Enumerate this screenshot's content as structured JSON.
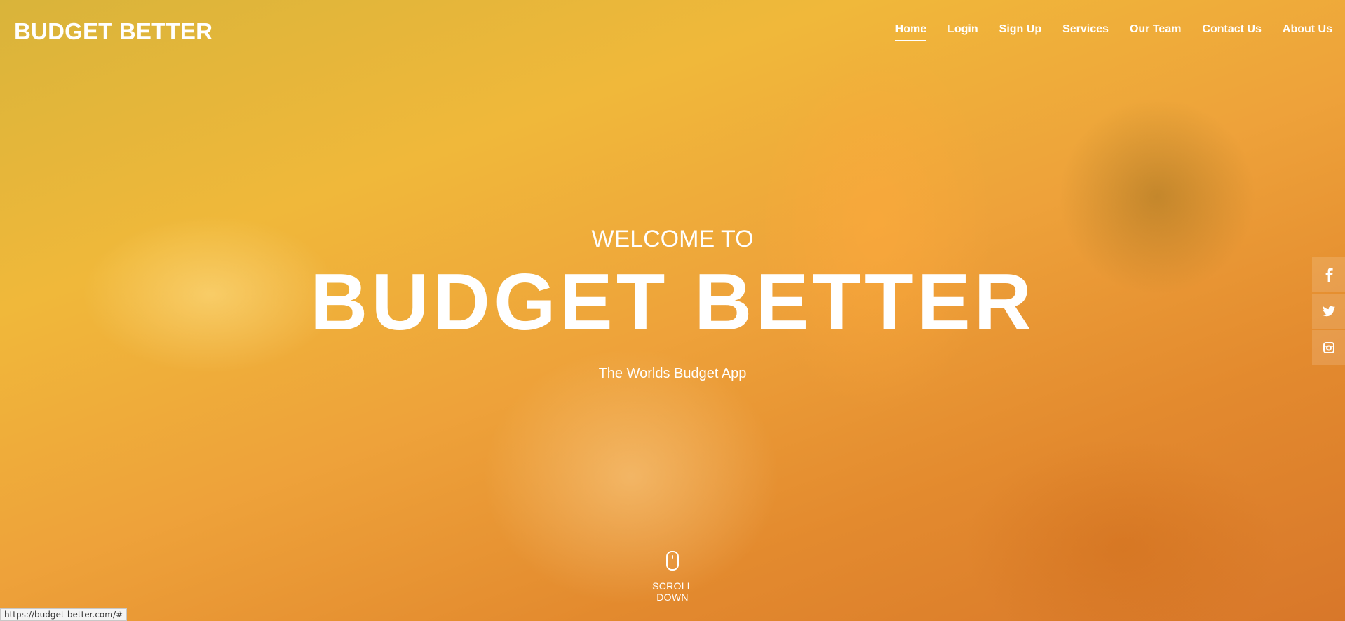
{
  "header": {
    "brand": "BUDGET BETTER",
    "nav": [
      {
        "label": "Home",
        "active": true
      },
      {
        "label": "Login"
      },
      {
        "label": "Sign Up"
      },
      {
        "label": "Services"
      },
      {
        "label": "Our Team"
      },
      {
        "label": "Contact Us"
      },
      {
        "label": "About Us"
      }
    ]
  },
  "hero": {
    "welcome": "WELCOME TO",
    "title": "BUDGET BETTER",
    "subtitle": "The Worlds Budget App",
    "scroll_label": "SCROLL DOWN",
    "scroll_icon": "mouse-icon"
  },
  "social": [
    {
      "icon": "facebook-icon",
      "glyph": "f"
    },
    {
      "icon": "twitter-icon",
      "glyph": "🐦"
    },
    {
      "icon": "instagram-icon",
      "glyph": "◙"
    }
  ],
  "status_bar": {
    "url": "https://budget-better.com/#"
  },
  "colors": {
    "text": "#ffffff",
    "overlay_top": "#f0b83a",
    "overlay_bottom": "#d8772a"
  }
}
